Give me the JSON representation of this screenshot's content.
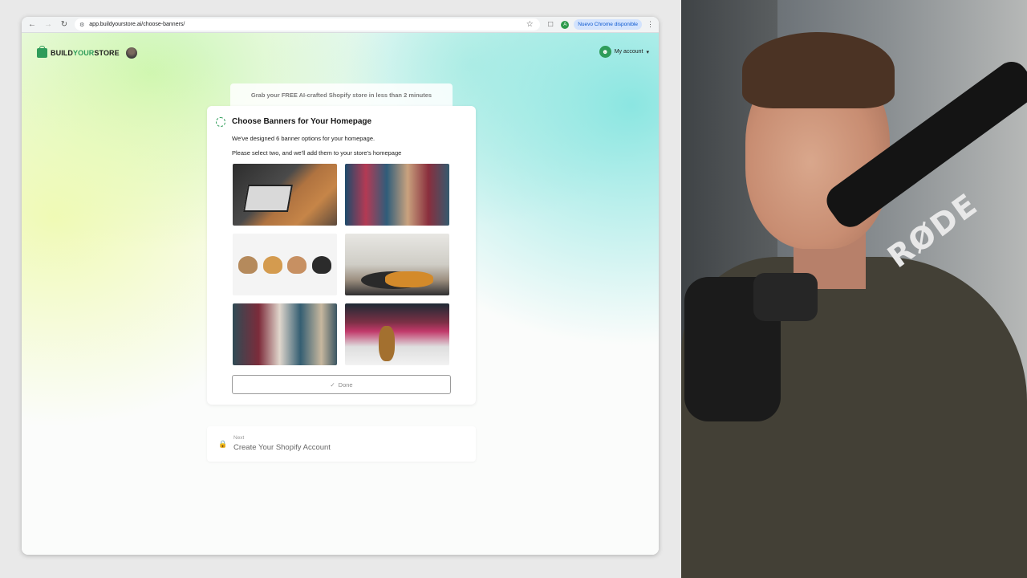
{
  "browser": {
    "url": "app.buildyourstore.ai/choose-banners/",
    "ext_badge": "A",
    "update_label": "Nuevo Chrome disponible"
  },
  "header": {
    "logo_build": "BUILD",
    "logo_your": "YOUR",
    "logo_store": "STORE",
    "account_label": "My account"
  },
  "promo": "Grab your FREE AI-crafted Shopify store in less than 2 minutes",
  "step": {
    "title": "Choose Banners for Your Homepage",
    "description": "We've designed 6 banner options for your homepage.",
    "instruction": "Please select two, and we'll add them to your store's homepage",
    "done_label": "Done"
  },
  "banners": [
    {
      "id": "banner-1",
      "subject": "dog-with-laptop"
    },
    {
      "id": "banner-2",
      "subject": "pet-store-shoppers"
    },
    {
      "id": "banner-3",
      "subject": "cats-and-dogs-peeking"
    },
    {
      "id": "banner-4",
      "subject": "pets-on-sofa-bed"
    },
    {
      "id": "banner-5",
      "subject": "family-in-pet-store"
    },
    {
      "id": "banner-6",
      "subject": "dog-in-store-aisle"
    }
  ],
  "next": {
    "label": "Next",
    "title": "Create Your Shopify Account"
  },
  "webcam": {
    "mic_brand": "RØDE"
  },
  "colors": {
    "brand_green": "#2f9c5a",
    "chrome_update_bg": "#d3e3fd",
    "chrome_update_text": "#0b57d0"
  }
}
